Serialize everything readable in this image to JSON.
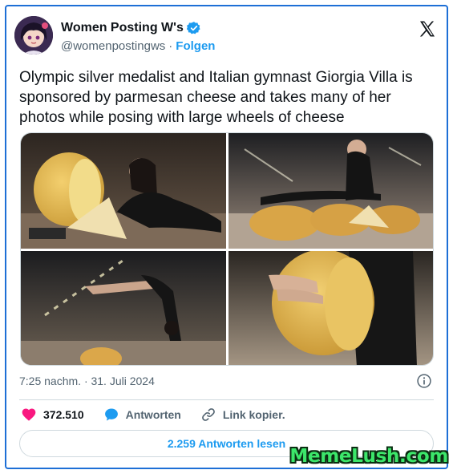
{
  "account": {
    "display_name": "Women Posting W's",
    "handle": "@womenpostingws",
    "separator": "·",
    "follow_label": "Folgen"
  },
  "post": {
    "text": "Olympic silver medalist and Italian gymnast Giorgia Villa is sponsored by parmesan cheese and takes many of her photos while posing with large wheels of cheese",
    "timestamp": "7:25 nachm. · 31. Juli 2024"
  },
  "actions": {
    "like_count": "372.510",
    "reply_label": "Antworten",
    "copy_link_label": "Link kopier."
  },
  "read_replies_label": "2.259 Antworten lesen",
  "watermark": "MemeLush.com",
  "colors": {
    "accent": "#1d9bf0",
    "like": "#f91880",
    "border": "#1d6fd6"
  },
  "icons": [
    "verified-badge-icon",
    "x-logo-icon",
    "info-icon",
    "heart-icon",
    "reply-bubble-icon",
    "link-icon"
  ]
}
